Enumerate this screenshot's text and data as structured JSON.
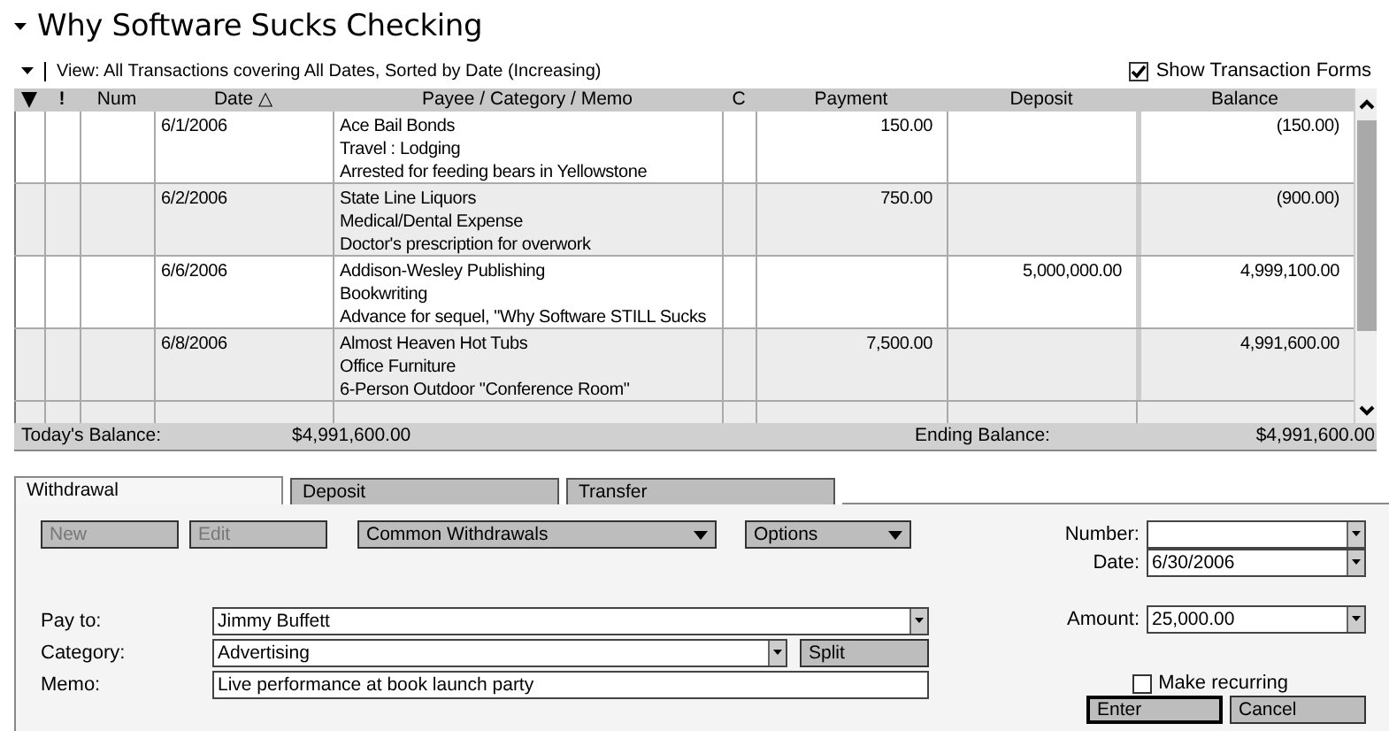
{
  "title": "Why Software Sucks Checking",
  "view": {
    "label": "View: All Transactions covering All Dates, Sorted by Date (Increasing)"
  },
  "show_forms": {
    "label": "Show Transaction Forms",
    "checked": true
  },
  "register": {
    "columns": [
      "!",
      "Num",
      "Date △",
      "Payee / Category / Memo",
      "C",
      "Payment",
      "Deposit",
      "Balance"
    ],
    "rows": [
      {
        "date": "6/1/2006",
        "payee": "Ace Bail Bonds",
        "category": "Travel : Lodging",
        "memo": "Arrested for feeding bears in Yellowstone",
        "payment": "150.00",
        "balance": "(150.00)"
      },
      {
        "date": "6/2/2006",
        "payee": "State Line Liquors",
        "category": "Medical/Dental Expense",
        "memo": "Doctor's prescription for overwork",
        "payment": "750.00",
        "balance": "(900.00)"
      },
      {
        "date": "6/6/2006",
        "payee": "Addison-Wesley Publishing",
        "category": "Bookwriting",
        "memo": "Advance for sequel, \"Why Software STILL Sucks",
        "deposit": "5,000,000.00",
        "balance": "4,999,100.00"
      },
      {
        "date": "6/8/2006",
        "payee": "Almost Heaven Hot Tubs",
        "category": "Office Furniture",
        "memo": "6-Person Outdoor \"Conference Room\"",
        "payment": "7,500.00",
        "balance": "4,991,600.00"
      }
    ],
    "todays_balance_label": "Today's Balance:",
    "todays_balance": "$4,991,600.00",
    "ending_balance_label": "Ending Balance:",
    "ending_balance": "$4,991,600.00"
  },
  "form": {
    "tabs": [
      {
        "label": "Withdrawal",
        "selected": true
      },
      {
        "label": "Deposit",
        "selected": false
      },
      {
        "label": "Transfer",
        "selected": false
      }
    ],
    "buttons": [
      {
        "label": "New",
        "kind": "button",
        "disabled": true
      },
      {
        "label": "Edit",
        "kind": "button",
        "disabled": true
      },
      {
        "label": "Common Withdrawals",
        "kind": "menu",
        "disabled": false
      },
      {
        "label": "Options",
        "kind": "menu",
        "disabled": false
      }
    ],
    "fields": [
      {
        "label": "Pay to:",
        "value": "Jimmy Buffett",
        "kind": "dropdown"
      },
      {
        "label": "Category:",
        "value": "Advertising",
        "kind": "split",
        "split": "Split"
      },
      {
        "label": "Memo:",
        "value": "Live performance at book launch party",
        "kind": "text"
      }
    ],
    "side_fields": [
      {
        "label": "Number:",
        "kind": "dropdown"
      },
      {
        "label": "Date:",
        "value": "6/30/2006",
        "kind": "dropdown"
      },
      {
        "label": "Amount:",
        "value": "25,000.00",
        "kind": "dropdown"
      }
    ],
    "make_recurring": {
      "label": "Make recurring",
      "checked": false
    },
    "actions": [
      "Enter",
      "Cancel"
    ]
  }
}
